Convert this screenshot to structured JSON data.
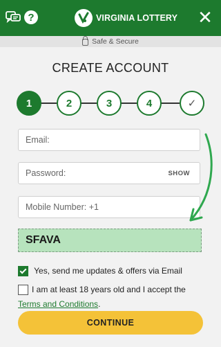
{
  "header": {
    "logo_text": "VIRGINIA LOTTERY",
    "chat_icon": "chat-bubbles-icon",
    "help_icon_glyph": "?",
    "close_glyph": "✕",
    "brand_color": "#1d7a2e"
  },
  "secure_bar": {
    "text": "Safe & Secure",
    "icon": "lock-icon"
  },
  "page": {
    "title": "CREATE ACCOUNT"
  },
  "steps": [
    "1",
    "2",
    "3",
    "4",
    "✓"
  ],
  "form": {
    "email_placeholder": "Email:",
    "password_placeholder": "Password:",
    "password_toggle": "SHOW",
    "mobile_placeholder": "Mobile Number: +1",
    "promo_code": "SFAVA",
    "promo_bg_color": "#b7e3bd"
  },
  "consents": {
    "email_updates": {
      "label": "Yes, send me updates & offers via Email",
      "checked": true
    },
    "age_terms": {
      "label_prefix": "I am at least 18 years old and I accept the ",
      "link_text": "Terms and Conditions",
      "label_suffix": ".",
      "checked": false
    }
  },
  "continue_button": {
    "label": "CONTINUE",
    "color": "#f4c238"
  },
  "annotation": {
    "arrow_color": "#2fa84f"
  }
}
